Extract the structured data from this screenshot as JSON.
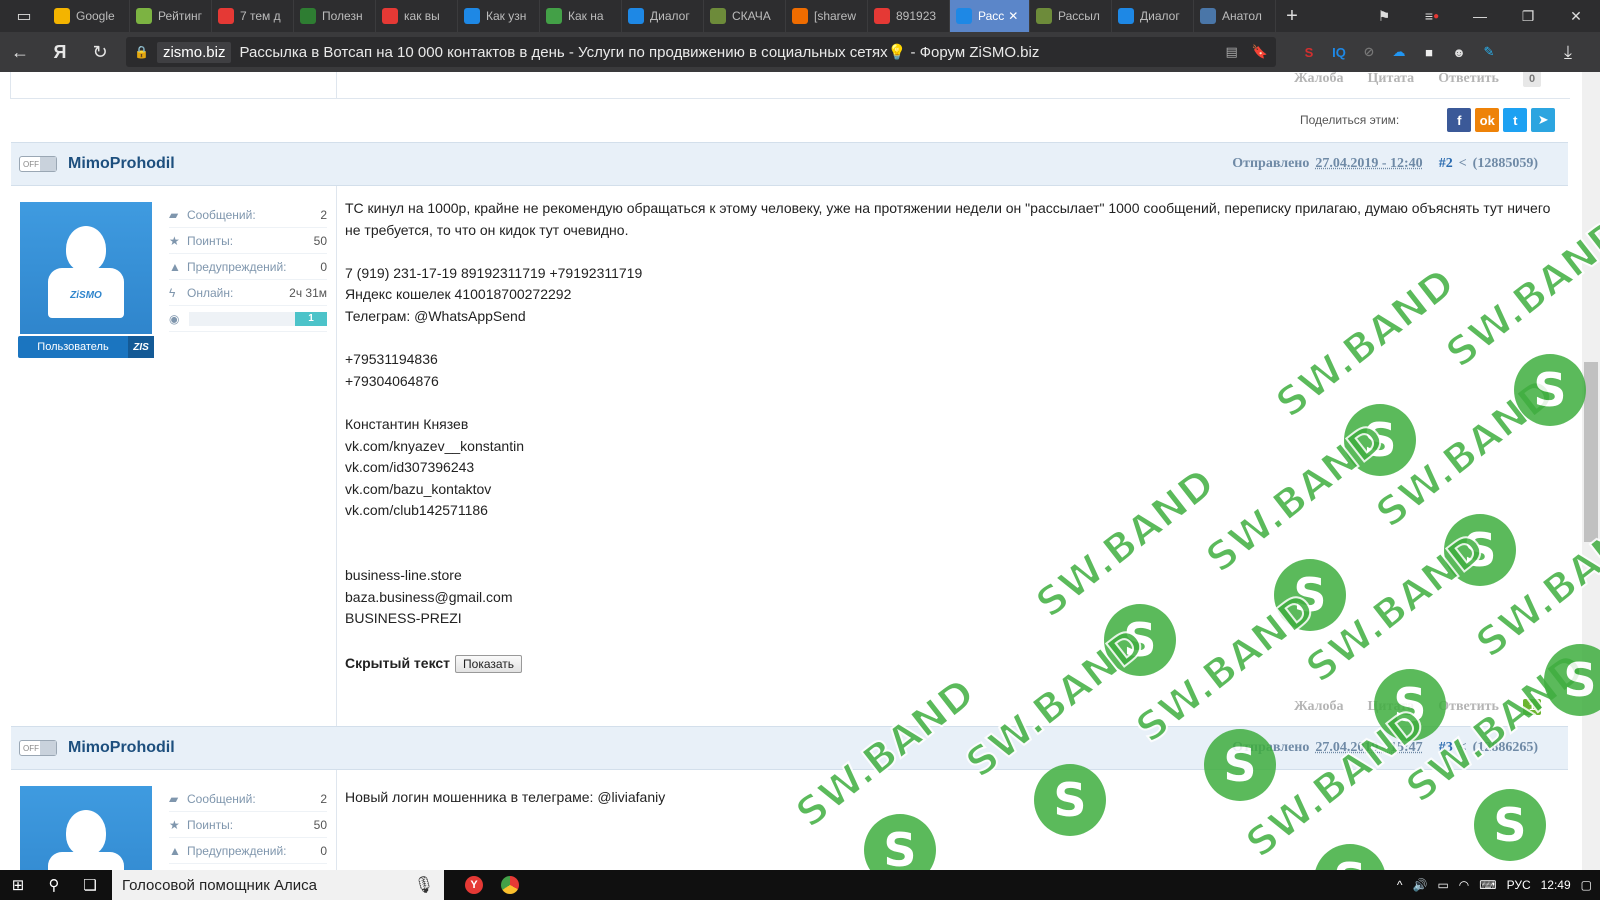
{
  "browser": {
    "tabs": [
      {
        "label": "Google",
        "icon": "lightbulb-icon",
        "color": "#f4b400"
      },
      {
        "label": "Рейтинг",
        "icon": "tick-icon",
        "color": "#7cb342"
      },
      {
        "label": "7 тем д",
        "icon": "t-icon",
        "color": "#e53935"
      },
      {
        "label": "Полезн",
        "icon": "plus-icon",
        "color": "#2e7d32"
      },
      {
        "label": "как вы",
        "icon": "yandex-icon",
        "color": "#e53935"
      },
      {
        "label": "Как узн",
        "icon": "gear-icon",
        "color": "#1e88e5"
      },
      {
        "label": "Как на",
        "icon": "leaf-icon",
        "color": "#43a047"
      },
      {
        "label": "Диалог",
        "icon": "chat-icon",
        "color": "#1e88e5"
      },
      {
        "label": "СКАЧА",
        "icon": "frog-icon",
        "color": "#6d8b3a"
      },
      {
        "label": "[sharew",
        "icon": "share-icon",
        "color": "#ef6c00"
      },
      {
        "label": "891923",
        "icon": "yandex-icon",
        "color": "#e53935"
      },
      {
        "label": "Расс",
        "icon": "zismo-icon",
        "color": "#1e88e5",
        "active": true
      },
      {
        "label": "Рассыл",
        "icon": "frog-icon",
        "color": "#6d8b3a"
      },
      {
        "label": "Диалог",
        "icon": "chat-icon",
        "color": "#1e88e5"
      },
      {
        "label": "Анатол",
        "icon": "vk-icon",
        "color": "#4a76a8"
      }
    ],
    "address": {
      "domain": "zismo.biz",
      "title": "Рассылка в Вотсап на 10 000 контактов в день - Услуги по продвижению в социальных сетях💡 - Форум ZiSMO.biz"
    },
    "extensions": [
      "ext-red-icon",
      "iq-icon",
      "eye-off-icon",
      "cloud-off-icon",
      "shield-icon",
      "ghost-icon",
      "feather-icon"
    ]
  },
  "forum": {
    "actions": {
      "report": "Жалоба",
      "quote": "Цитата",
      "reply": "Ответить"
    },
    "top_reply_count": "0",
    "share_label": "Поделиться этим:",
    "share_buttons": [
      {
        "icon": "facebook-icon",
        "glyph": "f",
        "color": "#3b5998"
      },
      {
        "icon": "odnoklassniki-icon",
        "glyph": "ok",
        "color": "#ee8208"
      },
      {
        "icon": "twitter-icon",
        "glyph": "t",
        "color": "#1da1f2"
      },
      {
        "icon": "telegram-icon",
        "glyph": "➤",
        "color": "#2ca5e0"
      }
    ],
    "posts": [
      {
        "username": "MimoProhodil",
        "status": "OFF",
        "sent_label": "Отправлено",
        "date": "27.04.2019 - 12:40",
        "number": "#2",
        "share_id": "(12885059)",
        "role": "Пользователь",
        "role_logo": "ZIS",
        "avatar_logo": "ZiSMO",
        "stats": [
          {
            "label": "Сообщений:",
            "value": "2",
            "icon": "messages-icon"
          },
          {
            "label": "Поинты:",
            "value": "50",
            "icon": "star-icon"
          },
          {
            "label": "Предупреждений:",
            "value": "0",
            "icon": "warning-icon"
          },
          {
            "label": "Онлайн:",
            "value": "2ч 31м",
            "icon": "lightning-icon"
          }
        ],
        "reputation_level": "1",
        "body_intro": "ТС кинул на 1000р, крайне не рекомендую обращаться к этому человеку, уже на протяжении недели он \"рассылает\" 1000 сообщений, переписку прилагаю, думаю объяснять тут ничего не требуется, то что он кидок тут очевидно.",
        "lines": [
          "",
          "7 (919) 231-17-19 89192311719 +79192311719",
          "Яндекс кошелек 410018700272292",
          "Телеграм: @WhatsAppSend",
          "",
          "+79531194836",
          "+79304064876",
          "",
          "Константин Князев",
          "vk.com/knyazev__konstantin",
          "vk.com/id307396243",
          "vk.com/bazu_kontaktov",
          "vk.com/club142571186",
          "",
          "",
          "business-line.store",
          "baza.business@gmail.com",
          "BUSINESS-PREZI",
          ""
        ],
        "hidden_label": "Скрытый текст",
        "show_button": "Показать",
        "reply_count": "1"
      },
      {
        "username": "MimoProhodil",
        "status": "OFF",
        "sent_label": "Отправлено",
        "date": "27.04.2019 - 15:47",
        "number": "#3",
        "share_id": "(12886265)",
        "stats": [
          {
            "label": "Сообщений:",
            "value": "2",
            "icon": "messages-icon"
          },
          {
            "label": "Поинты:",
            "value": "50",
            "icon": "star-icon"
          },
          {
            "label": "Предупреждений:",
            "value": "0",
            "icon": "warning-icon"
          }
        ],
        "body_intro": "Новый логин мошенника в телеграме: @liviafaniy"
      }
    ]
  },
  "watermark": {
    "text": "SW.BAND",
    "letter": "S",
    "color": "#3fae3f"
  },
  "taskbar": {
    "search_text": "Голосовой помощник Алиса",
    "lang": "РУС",
    "time": "12:49"
  }
}
